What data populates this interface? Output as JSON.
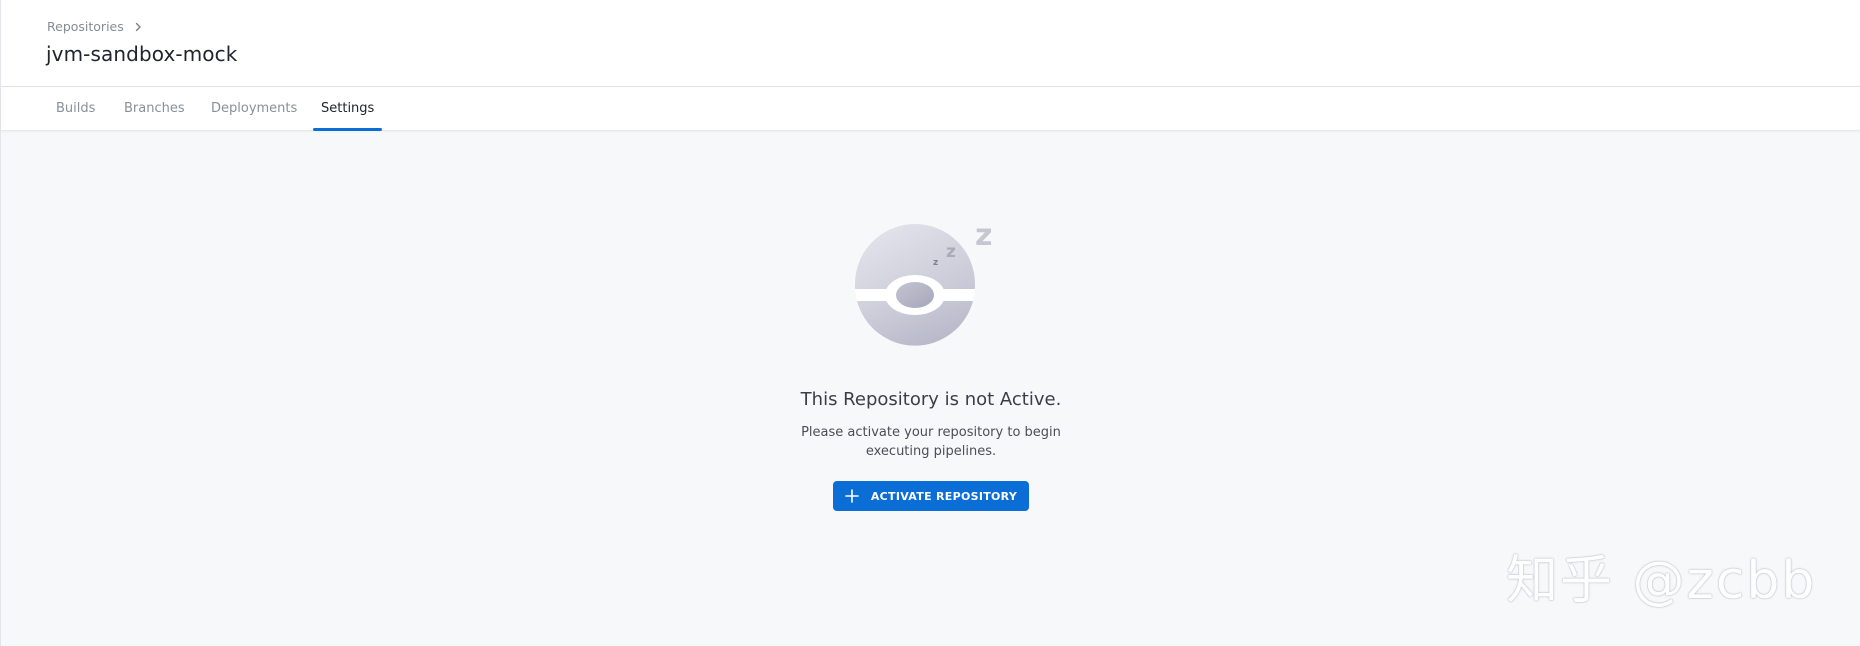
{
  "header": {
    "breadcrumb": "Repositories",
    "title": "jvm-sandbox-mock"
  },
  "tabs": [
    {
      "label": "Builds",
      "active": false
    },
    {
      "label": "Branches",
      "active": false
    },
    {
      "label": "Deployments",
      "active": false
    },
    {
      "label": "Settings",
      "active": true
    }
  ],
  "empty_state": {
    "title": "This Repository is not Active.",
    "description": "Please activate your repository to begin executing pipelines.",
    "button_label": "ACTIVATE REPOSITORY",
    "illustration_icon": "sleeping-ball-icon"
  },
  "watermark": "知乎 @zcbb",
  "colors": {
    "accent": "#0b6ed6",
    "background": "#f7f8fa"
  }
}
